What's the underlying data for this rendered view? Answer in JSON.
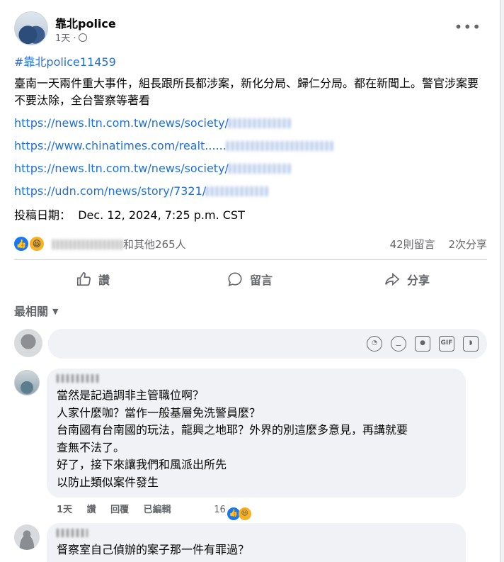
{
  "post": {
    "page_name": "靠北police",
    "time": "1天",
    "more_label": "•••",
    "hashtag": "#靠北police11459",
    "body": "臺南一天兩件重大事件，組長跟所長都涉案，新化分局、歸仁分局。都在新聞上。警官涉案要不要汰除，全台警察等著看",
    "links": [
      "https://news.ltn.com.tw/news/society/",
      "https://www.chinatimes.com/realt......",
      "https://news.ltn.com.tw/news/society/",
      "https://udn.com/news/story/7321/"
    ],
    "date_label": "投稿日期：",
    "date_value": "Dec. 12, 2024, 7:25 p.m. CST"
  },
  "reactions": {
    "names_suffix": "和其他265人",
    "comments": "42則留言",
    "shares": "2次分享"
  },
  "actions": {
    "like": "讚",
    "comment": "留言",
    "share": "分享"
  },
  "sort": {
    "label": "最相關"
  },
  "composer": {
    "icons": [
      "avatar-sticker-icon",
      "smiley-icon",
      "camera-icon",
      "gif-icon",
      "sticker-icon"
    ]
  },
  "comments": [
    {
      "lines": [
        "當然是記過調非主管職位啊？",
        "人家什麼咖？當作一般基層免洗警員麼？",
        "台南國有台南國的玩法，龍興之地耶？外界的別這麼多意見，再講就要",
        "查無不法了。",
        "好了，接下來讓我們和風派出所先",
        "以防止類似案件發生"
      ],
      "time": "1天",
      "like": "讚",
      "reply": "回覆",
      "edited": "已編輯",
      "reaction_count": "16"
    },
    {
      "lines": [
        "督察室自己偵辦的案子那一件有罪過？"
      ]
    }
  ],
  "colors": {
    "link": "#216fdb",
    "secondary": "#65676b",
    "like_blue": "#1877f2"
  }
}
